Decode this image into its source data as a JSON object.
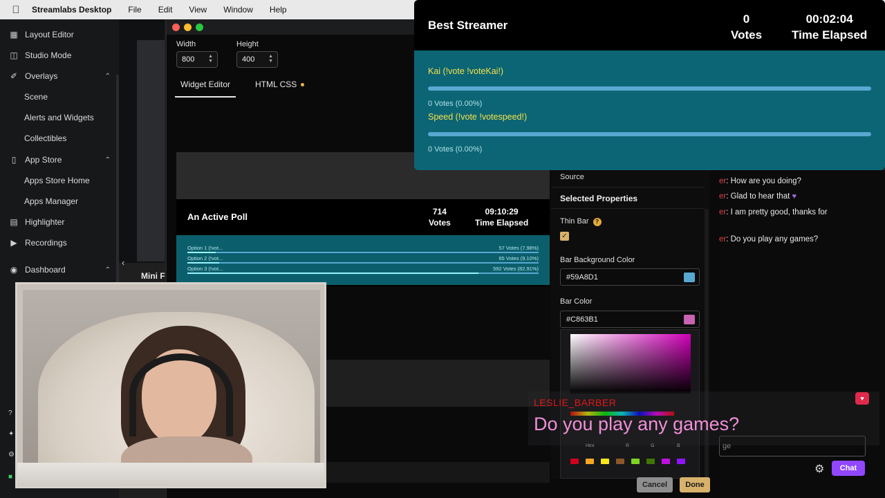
{
  "menubar": {
    "app_name": "Streamlabs Desktop",
    "items": [
      "File",
      "Edit",
      "View",
      "Window",
      "Help"
    ]
  },
  "sidebar": {
    "items": [
      {
        "label": "Layout Editor",
        "icon": "layout-grid-icon"
      },
      {
        "label": "Studio Mode",
        "icon": "studio-mode-icon"
      },
      {
        "label": "Overlays",
        "icon": "brush-icon"
      },
      {
        "label": "Scene"
      },
      {
        "label": "Alerts and Widgets"
      },
      {
        "label": "Collectibles"
      },
      {
        "label": "App Store",
        "icon": "store-icon"
      },
      {
        "label": "Apps Store Home"
      },
      {
        "label": "Apps Manager"
      },
      {
        "label": "Highlighter",
        "icon": "highlighter-icon"
      },
      {
        "label": "Recordings",
        "icon": "play-icon"
      },
      {
        "label": "Dashboard",
        "icon": "dashboard-icon"
      }
    ],
    "mini_label": "Mini F"
  },
  "widget_editor": {
    "width_label": "Width",
    "width_value": "800",
    "height_label": "Height",
    "height_value": "400",
    "tabs": [
      "Widget Editor",
      "HTML CSS"
    ],
    "preview_poll": {
      "title": "An Active Poll",
      "votes_value": "714",
      "votes_label": "Votes",
      "time_value": "09:10:29",
      "time_label": "Time Elapsed",
      "options": [
        {
          "label": "Option 1 (!vot...",
          "votes": "57 Votes (7.98%)",
          "fraction": 0.0798
        },
        {
          "label": "Option 2 (!vot...",
          "votes": "65 Votes (9.10%)",
          "fraction": 0.091
        },
        {
          "label": "Option 3 (!vot...",
          "votes": "592 Votes (82.91%)",
          "fraction": 0.8291
        }
      ]
    },
    "props": {
      "source_label": "Source",
      "selected_heading": "Selected Properties",
      "thin_bar_label": "Thin Bar",
      "help_glyph": "?",
      "bar_bg_label": "Bar Background Color",
      "bar_bg_value": "#59A8D1",
      "bar_color_label": "Bar Color",
      "bar_color_value": "#C863B1",
      "picker_labels": [
        "Hex",
        "R",
        "G",
        "B"
      ],
      "preset_colors": [
        "#d0021b",
        "#f5a623",
        "#f8e71c",
        "#8b572a",
        "#7ed321",
        "#417505",
        "#bd10e0",
        "#9013fe"
      ]
    },
    "cancel_label": "Cancel",
    "done_label": "Done"
  },
  "poll_overlay": {
    "title": "Best Streamer",
    "votes_value": "0",
    "votes_label": "Votes",
    "time_value": "00:02:04",
    "time_label": "Time Elapsed",
    "options": [
      {
        "label": "Kai (!vote !voteKai!)",
        "votes": "0 Votes (0.00%)"
      },
      {
        "label": "Speed (!vote !votespeed!)",
        "votes": "0 Votes (0.00%)"
      }
    ]
  },
  "chat": {
    "messages": [
      {
        "name": "er",
        "text": ": How are you doing?"
      },
      {
        "name": "er",
        "text": ": Glad to hear that"
      },
      {
        "name": "er",
        "text": ": I am pretty good, thanks for"
      },
      {
        "name": "er",
        "text": ": Do you play any games?"
      }
    ],
    "input_placeholder": "ge",
    "chat_button": "Chat"
  },
  "highlight": {
    "username": "LESLIE_BARBER",
    "message": "Do you play any games?"
  },
  "colors": {
    "bar_background": "#59A8D1",
    "bar_color": "#C863B1",
    "poll_body": "#0c6574",
    "chat_button": "#9147ff",
    "done_button": "#d8b26b"
  }
}
